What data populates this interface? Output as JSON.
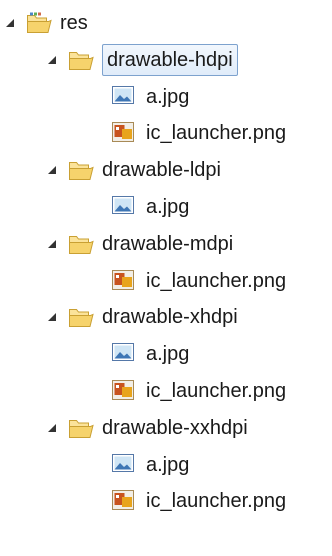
{
  "tree": {
    "root": {
      "label": "res",
      "expanded": true,
      "icon": "resource-folder-icon"
    },
    "folders": [
      {
        "label": "drawable-hdpi",
        "expanded": true,
        "selected": true,
        "icon": "folder-open-icon",
        "files": [
          {
            "label": "a.jpg",
            "icon": "image-file-icon"
          },
          {
            "label": "ic_launcher.png",
            "icon": "png-file-icon"
          }
        ]
      },
      {
        "label": "drawable-ldpi",
        "expanded": true,
        "selected": false,
        "icon": "folder-open-icon",
        "files": [
          {
            "label": "a.jpg",
            "icon": "image-file-icon"
          }
        ]
      },
      {
        "label": "drawable-mdpi",
        "expanded": true,
        "selected": false,
        "icon": "folder-open-icon",
        "files": [
          {
            "label": "ic_launcher.png",
            "icon": "png-file-icon"
          }
        ]
      },
      {
        "label": "drawable-xhdpi",
        "expanded": true,
        "selected": false,
        "icon": "folder-open-icon",
        "files": [
          {
            "label": "a.jpg",
            "icon": "image-file-icon"
          },
          {
            "label": "ic_launcher.png",
            "icon": "png-file-icon"
          }
        ]
      },
      {
        "label": "drawable-xxhdpi",
        "expanded": true,
        "selected": false,
        "icon": "folder-open-icon",
        "files": [
          {
            "label": "a.jpg",
            "icon": "image-file-icon"
          },
          {
            "label": "ic_launcher.png",
            "icon": "png-file-icon"
          }
        ]
      }
    ]
  },
  "colors": {
    "selection_border": "#7da2ce",
    "selection_fill": "#e0ecfa",
    "folder": "#f3cf62",
    "expander": "#333333"
  }
}
